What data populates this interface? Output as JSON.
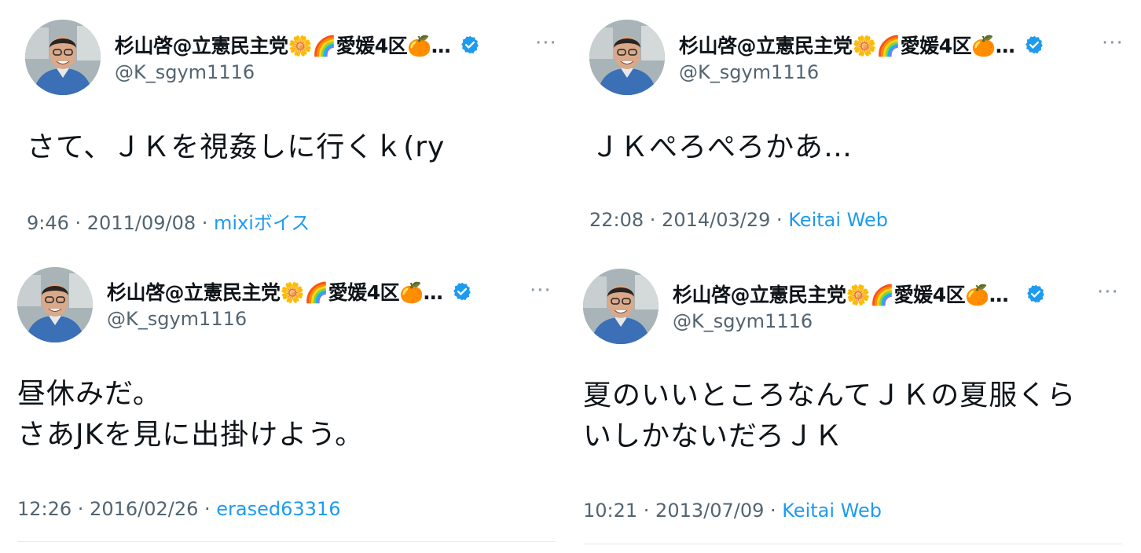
{
  "author": {
    "display_name": "杉山啓@立憲民主党🌼🌈愛媛4区🍊…",
    "handle": "@K_sgym1116",
    "verified_color": "#1d9bf0",
    "avatar_icon": "profile-photo",
    "more_icon": "···"
  },
  "tweets": [
    {
      "lines": [
        "さて、ＪＫを視姦しに行くｋ(ry"
      ],
      "time": "9:46 · 2011/09/08 · ",
      "source": "mixiボイス"
    },
    {
      "lines": [
        "ＪＫぺろぺろかあ…"
      ],
      "time": "22:08 · 2014/03/29 · ",
      "source": "Keitai Web"
    },
    {
      "lines": [
        "昼休みだ。",
        "さあJKを見に出掛けよう。"
      ],
      "time": "12:26 · 2016/02/26 · ",
      "source": "erased63316"
    },
    {
      "lines": [
        "夏のいいところなんてＪＫの夏服くら",
        "いしかないだろＪＫ"
      ],
      "time": "10:21 · 2013/07/09 · ",
      "source": "Keitai Web"
    }
  ]
}
